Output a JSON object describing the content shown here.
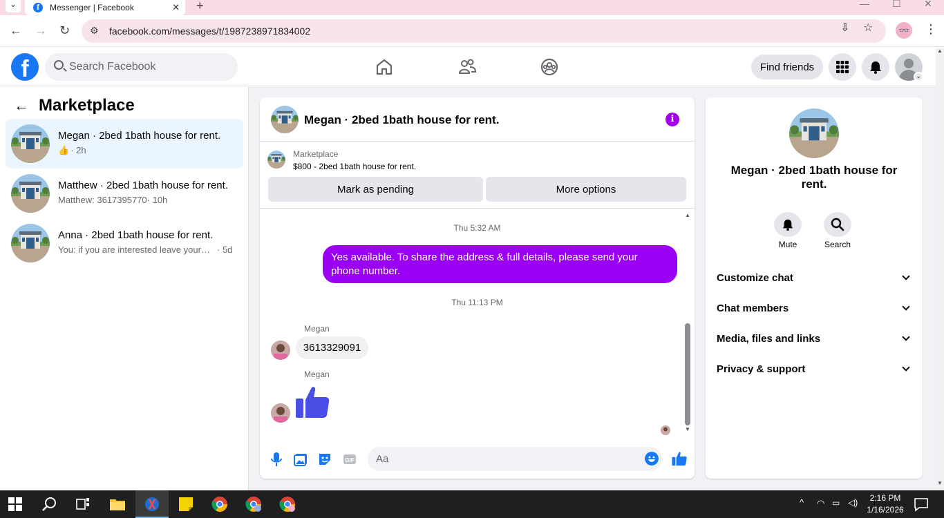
{
  "browser": {
    "tab_title": "Messenger | Facebook",
    "url": "facebook.com/messages/t/1987238971834002"
  },
  "header": {
    "search_placeholder": "Search Facebook",
    "find_friends": "Find friends"
  },
  "sidebar": {
    "title": "Marketplace",
    "conversations": [
      {
        "name": "Megan · 2bed 1bath house for rent.",
        "preview": "",
        "time": "· 2h",
        "active": true
      },
      {
        "name": "Matthew · 2bed 1bath house for rent.",
        "preview": "Matthew: 3617395770",
        "time": "· 10h",
        "active": false
      },
      {
        "name": "Anna · 2bed 1bath house for rent.",
        "preview": "You: if you are interested leave your phone number",
        "time": "· 5d",
        "active": false
      }
    ]
  },
  "chat": {
    "title": "Megan · 2bed 1bath house for rent.",
    "marketplace_label": "Marketplace",
    "listing": "$800 - 2bed 1bath house for rent.",
    "mark_pending": "Mark as pending",
    "more_options": "More options",
    "messages": {
      "ts1": "Thu 5:32 AM",
      "outgoing": "Yes available. To share the address & full details, please send your phone number.",
      "ts2": "Thu 11:13 PM",
      "sender1": "Megan",
      "incoming": "3613329091",
      "sender2": "Megan"
    },
    "composer_placeholder": "Aa"
  },
  "details": {
    "title": "Megan · 2bed 1bath house for rent.",
    "mute": "Mute",
    "search": "Search",
    "rows": [
      "Customize chat",
      "Chat members",
      "Media, files and links",
      "Privacy & support"
    ]
  },
  "taskbar": {
    "time": "2:16 PM",
    "date": "1/16/2026"
  },
  "colors": {
    "fb_blue": "#1877f2",
    "chat_purple": "#9b00f5",
    "active_row": "#ebf5ff"
  }
}
